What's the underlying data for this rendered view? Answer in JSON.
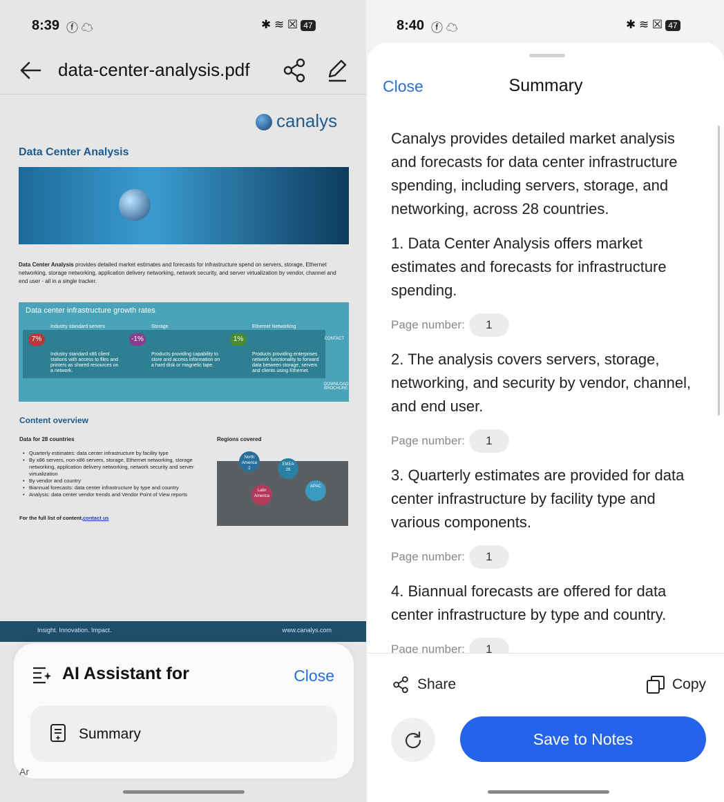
{
  "left": {
    "status": {
      "time": "8:39",
      "battery": "47"
    },
    "toolbar": {
      "filename": "data-center-analysis.pdf"
    },
    "pdf": {
      "logo": "canalys",
      "title": "Data Center Analysis",
      "intro_bold": "Data Center Analysis",
      "intro_rest": " provides detailed market estimates and forecasts for infrastructure spend on servers, storage, Ethernet networking, storage networking, application delivery networking, network security, and server virtualization by vendor, channel and end user - all in a single tracker.",
      "banner_title": "Data center infrastructure growth rates",
      "segments": [
        {
          "label": "Industry standard servers",
          "pct": "7%",
          "desc": "Industry standard x86 client stations with access to files and printers as shared resources on a network."
        },
        {
          "label": "Storage",
          "pct": "-1%",
          "desc": "Products providing capability to store and access information on a hard disk or magnetic tape."
        },
        {
          "label": "Ethernet Networking",
          "pct": "1%",
          "desc": "Products providing enterprises network functionality to forward data between storage, servers and clients using Ethernet."
        }
      ],
      "contact": "CONTACT",
      "download": "DOWNLOAD BROCHURE",
      "overview_title": "Content overview",
      "data_heading": "Data for 28 countries",
      "regions_heading": "Regions covered",
      "bullets": [
        "Quarterly estimates: data center infrastructure by facility type",
        "By x86 servers, non-x86 servers, storage, Ethernet networking, storage networking, application delivery networking, network security and server virtualization",
        "By vendor and country",
        "Biannual forecasts: data center infrastructure by type and country",
        "Analysis: data center vendor trends and Vendor Point of View reports"
      ],
      "full_list": "For the full list of content,",
      "contact_link": "contact us",
      "regions": [
        {
          "name": "North America",
          "count": "2"
        },
        {
          "name": "EMEA",
          "count": "26"
        },
        {
          "name": "Latin America",
          "count": ""
        },
        {
          "name": "APAC",
          "count": ""
        }
      ],
      "footer_left": "Insight. Innovation. Impact.",
      "footer_right": "www.canalys.com"
    },
    "ai_sheet": {
      "title": "AI Assistant for",
      "close": "Close",
      "summary_label": "Summary"
    },
    "peek_text": "Ar"
  },
  "right": {
    "status": {
      "time": "8:40",
      "battery": "47"
    },
    "header": {
      "close": "Close",
      "title": "Summary"
    },
    "intro": "Canalys provides detailed market analysis and forecasts for data center infrastructure spending, including servers, storage, and networking, across 28 countries.",
    "page_label": "Page number:",
    "items": [
      {
        "text": "1. Data Center Analysis offers market estimates and forecasts for infrastructure spending.",
        "page": "1"
      },
      {
        "text": "2.  The analysis covers servers, storage, networking, and security by vendor, channel, and end user.",
        "page": "1"
      },
      {
        "text": "3. Quarterly estimates are provided for data center infrastructure by facility type and various components.",
        "page": "1"
      },
      {
        "text": "4. Biannual forecasts are offered for data center infrastructure by type and country.",
        "page": "1"
      }
    ],
    "actions": {
      "share": "Share",
      "copy": "Copy",
      "save": "Save to Notes"
    }
  },
  "colors": {
    "accent": "#2563eb",
    "link": "#2a6fd6",
    "pdf_blue": "#1e5b8e"
  },
  "icons": [
    "back-arrow-icon",
    "share-icon",
    "edit-pencil-icon",
    "ai-sparkle-list-icon",
    "document-summary-icon",
    "copy-icon",
    "refresh-icon",
    "bluetooth-icon",
    "wifi-icon",
    "facebook-icon",
    "cloud-icon"
  ]
}
